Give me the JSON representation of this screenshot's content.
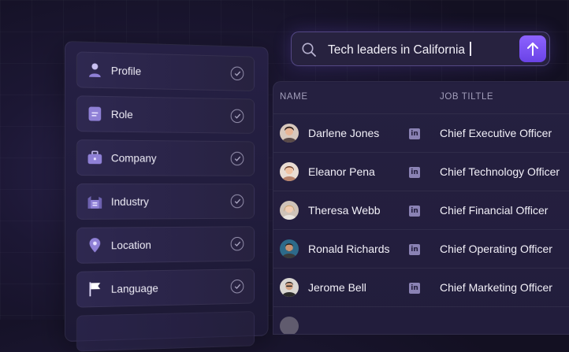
{
  "search": {
    "query": "Tech leaders in California",
    "icon": "search-icon",
    "submit_icon": "arrow-up-icon"
  },
  "filters": [
    {
      "label": "Profile",
      "icon": "person-icon",
      "checked": true
    },
    {
      "label": "Role",
      "icon": "document-icon",
      "checked": true
    },
    {
      "label": "Company",
      "icon": "briefcase-icon",
      "checked": true
    },
    {
      "label": "Industry",
      "icon": "building-icon",
      "checked": true
    },
    {
      "label": "Location",
      "icon": "map-pin-icon",
      "checked": true
    },
    {
      "label": "Language",
      "icon": "flag-icon",
      "checked": true
    }
  ],
  "table": {
    "headers": {
      "name": "NAME",
      "title": "JOB TILTLE"
    },
    "rows": [
      {
        "name": "Darlene Jones",
        "title": "Chief Executive Officer",
        "social": "linkedin-icon"
      },
      {
        "name": "Eleanor Pena",
        "title": "Chief Technology Officer",
        "social": "linkedin-icon"
      },
      {
        "name": "Theresa Webb",
        "title": "Chief Financial Officer",
        "social": "linkedin-icon"
      },
      {
        "name": "Ronald Richards",
        "title": "Chief Operating Officer",
        "social": "linkedin-icon"
      },
      {
        "name": "Jerome Bell",
        "title": "Chief Marketing Officer",
        "social": "linkedin-icon"
      }
    ]
  },
  "colors": {
    "accent": "#7b52f5",
    "icon_tint": "#a59ae0"
  }
}
